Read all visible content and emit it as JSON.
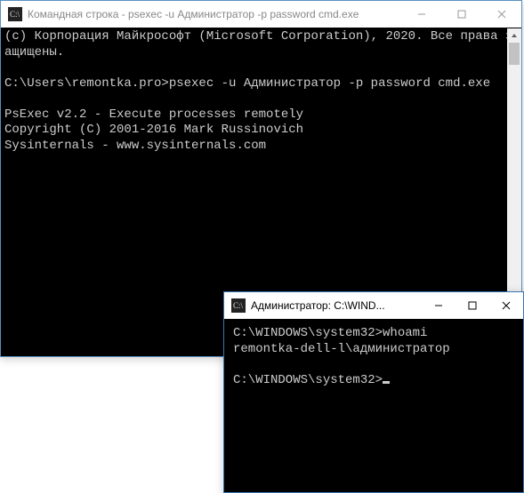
{
  "back_window": {
    "title": "Командная строка - psexec  -u Администратор -p password cmd.exe",
    "terminal": {
      "copyright1": "(c) Корпорация Майкрософт (Microsoft Corporation), 2020. Все права защищены.",
      "prompt1": "C:\\Users\\remontka.pro>psexec -u Администратор -p password cmd.exe",
      "psexec1": "PsExec v2.2 - Execute processes remotely",
      "psexec2": "Copyright (C) 2001-2016 Mark Russinovich",
      "psexec3": "Sysinternals - www.sysinternals.com"
    }
  },
  "front_window": {
    "title": "Администратор: C:\\WIND...",
    "terminal": {
      "line1_prompt": "C:\\WINDOWS\\system32>",
      "line1_cmd": "whoami",
      "line2": "remontka-dell-l\\администратор",
      "line3_prompt": "C:\\WINDOWS\\system32>"
    }
  },
  "controls": {
    "minimize": "—",
    "maximize": "▢",
    "close": "✕"
  }
}
